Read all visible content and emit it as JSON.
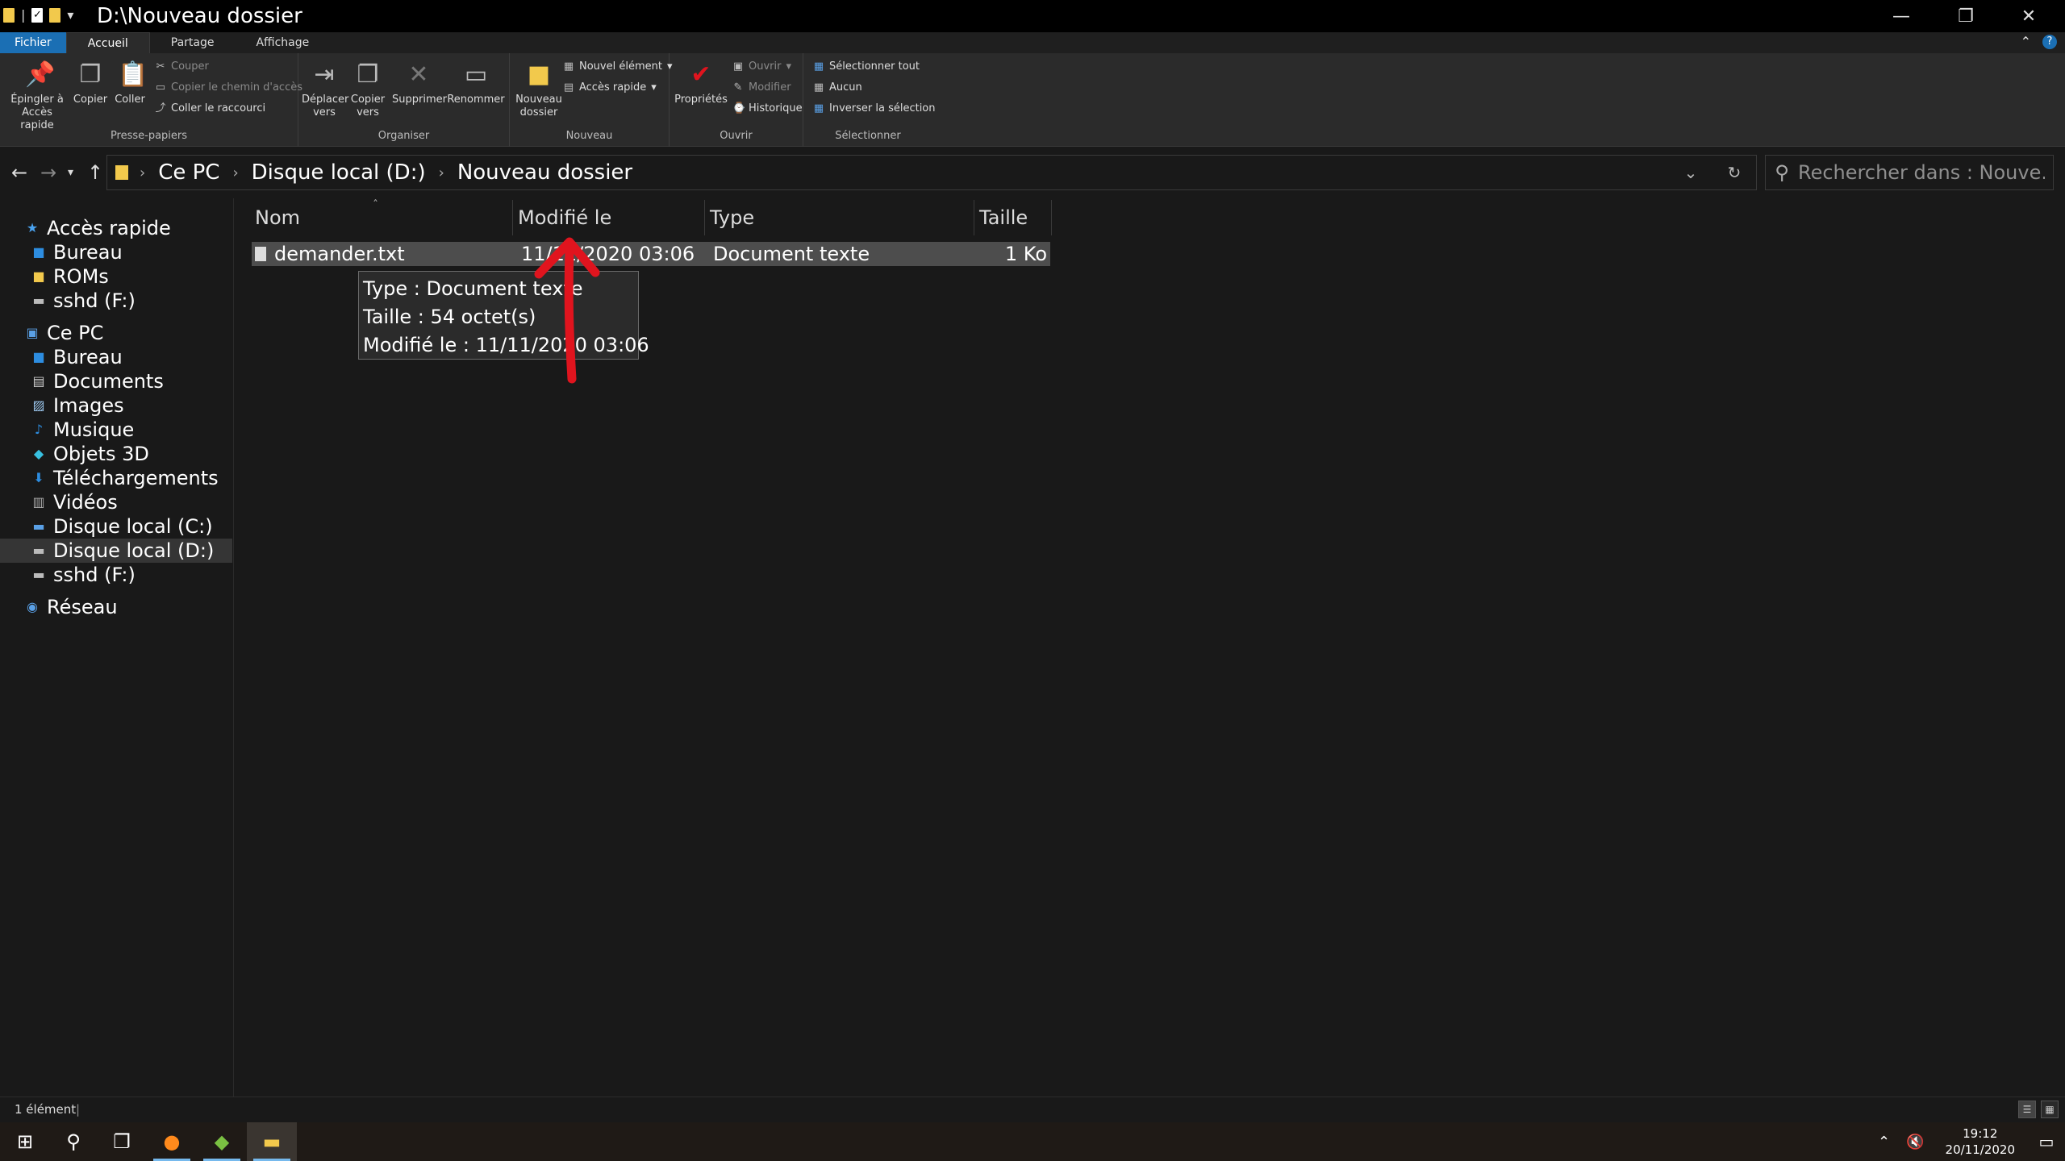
{
  "window": {
    "title": "D:\\Nouveau dossier",
    "controls": {
      "minimize": "—",
      "restore": "❐",
      "close": "✕"
    }
  },
  "ribbon": {
    "tabs": [
      {
        "label": "Fichier"
      },
      {
        "label": "Accueil"
      },
      {
        "label": "Partage"
      },
      {
        "label": "Affichage"
      }
    ],
    "groups": {
      "clipboard": {
        "label": "Presse-papiers",
        "pin_line1": "Épingler à",
        "pin_line2": "Accès rapide",
        "copy": "Copier",
        "paste": "Coller",
        "cut": "Couper",
        "copy_path": "Copier le chemin d'accès",
        "paste_shortcut": "Coller le raccourci"
      },
      "organize": {
        "label": "Organiser",
        "move_line1": "Déplacer",
        "move_line2": "vers",
        "copyto_line1": "Copier",
        "copyto_line2": "vers",
        "delete": "Supprimer",
        "rename": "Renommer"
      },
      "new": {
        "label": "Nouveau",
        "newfolder_line1": "Nouveau",
        "newfolder_line2": "dossier",
        "new_item": "Nouvel élément",
        "easy_access": "Accès rapide"
      },
      "open": {
        "label": "Ouvrir",
        "properties": "Propriétés",
        "open": "Ouvrir",
        "edit": "Modifier",
        "history": "Historique"
      },
      "select": {
        "label": "Sélectionner",
        "select_all": "Sélectionner tout",
        "select_none": "Aucun",
        "invert": "Inverser la sélection"
      }
    }
  },
  "address": {
    "breadcrumbs": [
      "Ce PC",
      "Disque local (D:)",
      "Nouveau dossier"
    ],
    "search_placeholder": "Rechercher dans : Nouve..."
  },
  "nav": {
    "quick_access": "Accès rapide",
    "quick_items": [
      "Bureau",
      "ROMs",
      "sshd (F:)"
    ],
    "this_pc": "Ce PC",
    "pc_items": [
      "Bureau",
      "Documents",
      "Images",
      "Musique",
      "Objets 3D",
      "Téléchargements",
      "Vidéos",
      "Disque local (C:)",
      "Disque local (D:)",
      "sshd (F:)"
    ],
    "network": "Réseau"
  },
  "columns": [
    "Nom",
    "Modifié le",
    "Type",
    "Taille"
  ],
  "files": [
    {
      "name": "demander.txt",
      "modified": "11/11/2020 03:06",
      "type": "Document texte",
      "size": "1 Ko"
    }
  ],
  "tooltip": {
    "line1": "Type : Document texte",
    "line2": "Taille : 54 octet(s)",
    "line3": "Modifié le : 11/11/2020 03:06"
  },
  "status": {
    "count": "1 élément"
  },
  "taskbar": {
    "time": "19:12",
    "date": "20/11/2020"
  },
  "colors": {
    "accent": "#1b6fb4",
    "annotation_arrow": "#e0141e",
    "selection": "#4d4d4d"
  }
}
